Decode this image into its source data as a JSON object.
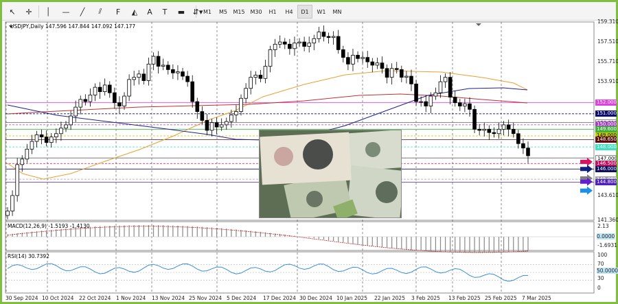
{
  "toolbar": {
    "tools": [
      {
        "name": "cursor-icon",
        "glyph": "↖"
      },
      {
        "name": "crosshair-icon",
        "glyph": "✛"
      },
      {
        "name": "vertical-line-icon",
        "glyph": "│"
      },
      {
        "name": "horizontal-line-icon",
        "glyph": "—"
      },
      {
        "name": "trendline-icon",
        "glyph": "╱"
      },
      {
        "name": "channel-icon",
        "glyph": "⫽"
      },
      {
        "name": "fibonacci-icon",
        "glyph": "F"
      },
      {
        "name": "shapes-icon",
        "glyph": "◭"
      },
      {
        "name": "text-icon",
        "glyph": "A"
      },
      {
        "name": "text-label-icon",
        "glyph": "T"
      },
      {
        "name": "rectangle-icon",
        "glyph": "▬"
      },
      {
        "name": "arrows-dropdown-icon",
        "glyph": "⇵▾"
      }
    ],
    "timeframes": [
      "M1",
      "M5",
      "M15",
      "M30",
      "H1",
      "H4",
      "D1",
      "W1",
      "MN"
    ],
    "active_timeframe": "D1"
  },
  "chart": {
    "symbol_label": "USDJPY,Daily  147.596 147.844 147.092 147.177",
    "macd_label": "MACD(12,26,9) -1.5193 -1.4130",
    "rsi_label": "RSI(14) 30.7392",
    "price_axis": [
      "159.310",
      "157.510",
      "155.710",
      "153.910",
      "143.610",
      "141.360"
    ],
    "price_tags": [
      {
        "text": "152.000",
        "bg": "#e040e0",
        "fg": "#ffffff"
      },
      {
        "text": "151.000",
        "bg": "#0b0b6e",
        "fg": "#ffffff"
      },
      {
        "text": "150.210",
        "bg": "#ffffff",
        "fg": "#333333"
      },
      {
        "text": "150.000",
        "bg": "#a040c0",
        "fg": "#ffffff"
      },
      {
        "text": "149.600",
        "bg": "#40b040",
        "fg": "#ffffff"
      },
      {
        "text": "149.000",
        "bg": "#c8c800",
        "fg": "#000000"
      },
      {
        "text": "148.650",
        "bg": "#5a0f0f",
        "fg": "#ffffff"
      },
      {
        "text": "148.000",
        "bg": "#40e0c0",
        "fg": "#ffffff"
      },
      {
        "text": "147.000",
        "bg": "#ffffff",
        "fg": "#000000"
      },
      {
        "text": "146.500",
        "bg": "#c01060",
        "fg": "#ffffff"
      },
      {
        "text": "146.000",
        "bg": "#101060",
        "fg": "#ffffff"
      },
      {
        "text": "145.080",
        "bg": "#a0a0a0",
        "fg": "#ffffff"
      },
      {
        "text": "144.800",
        "bg": "#5020c0",
        "fg": "#ffffff"
      }
    ],
    "macd_axis": [
      "2.13",
      "0.0000",
      "-1.6931"
    ],
    "rsi_axis": [
      "100",
      "70",
      "50.0000",
      "30",
      "0"
    ],
    "dates": [
      "30 Sep 2024",
      "10 Oct 2024",
      "22 Oct 2024",
      "1 Nov 2024",
      "13 Nov 2024",
      "25 Nov 2024",
      "5 Dec 2024",
      "17 Dec 2024",
      "30 Dec 2024",
      "10 Jan 2025",
      "22 Jan 2025",
      "3 Feb 2025",
      "13 Feb 2025",
      "25 Feb 2025",
      "7 Mar 2025"
    ],
    "colors": {
      "bull_candle": "#ffffff",
      "bear_candle": "#000000",
      "ma_short": "#e8a030",
      "ma_mid": "#c03030",
      "ma_long": "#202090",
      "macd_signal": "#c02020",
      "rsi_line": "#3a8fd8"
    }
  },
  "chart_data": {
    "type": "candlestick",
    "symbol": "USDJPY",
    "timeframe": "Daily",
    "ohlc_last": {
      "open": 147.596,
      "high": 147.844,
      "low": 147.092,
      "close": 147.177
    },
    "ylim": [
      141.36,
      159.31
    ],
    "closes": [
      142.2,
      143.6,
      146.4,
      146.9,
      147.8,
      148.5,
      149.1,
      148.9,
      148.4,
      148.9,
      149.2,
      149.7,
      150.0,
      150.8,
      151.6,
      152.3,
      152.1,
      152.7,
      153.4,
      153.0,
      153.6,
      152.9,
      152.0,
      151.7,
      152.6,
      154.1,
      154.3,
      154.6,
      154.0,
      155.5,
      156.2,
      155.3,
      155.4,
      155.0,
      154.7,
      154.8,
      154.4,
      153.9,
      152.1,
      151.2,
      150.4,
      149.5,
      150.2,
      149.8,
      150.0,
      150.3,
      150.9,
      151.2,
      152.4,
      153.3,
      154.3,
      154.5,
      154.2,
      155.3,
      156.8,
      157.3,
      157.5,
      157.3,
      156.9,
      157.4,
      157.5,
      157.1,
      157.4,
      157.8,
      158.4,
      158.0,
      157.9,
      158.0,
      156.8,
      156.1,
      155.5,
      156.3,
      156.0,
      156.1,
      155.7,
      155.4,
      155.6,
      155.1,
      154.3,
      155.1,
      155.0,
      154.3,
      154.4,
      153.7,
      152.1,
      152.1,
      151.7,
      152.6,
      152.9,
      153.9,
      154.3,
      152.5,
      152.0,
      151.7,
      151.9,
      151.4,
      149.6,
      149.5,
      149.6,
      149.3,
      149.2,
      149.6,
      150.0,
      149.6,
      149.2,
      148.3,
      147.9,
      147.2
    ],
    "horizontal_levels": [
      152.0,
      151.0,
      150.21,
      150.0,
      149.6,
      149.0,
      148.65,
      148.0,
      147.0,
      146.5,
      146.0,
      145.08,
      144.8
    ],
    "macd": {
      "main": -1.5193,
      "signal": -1.413,
      "axis_range": [
        -1.6931,
        2.13
      ]
    },
    "rsi": {
      "value": 30.7392,
      "levels": [
        70,
        50,
        30
      ],
      "axis_range": [
        0,
        100
      ]
    }
  }
}
